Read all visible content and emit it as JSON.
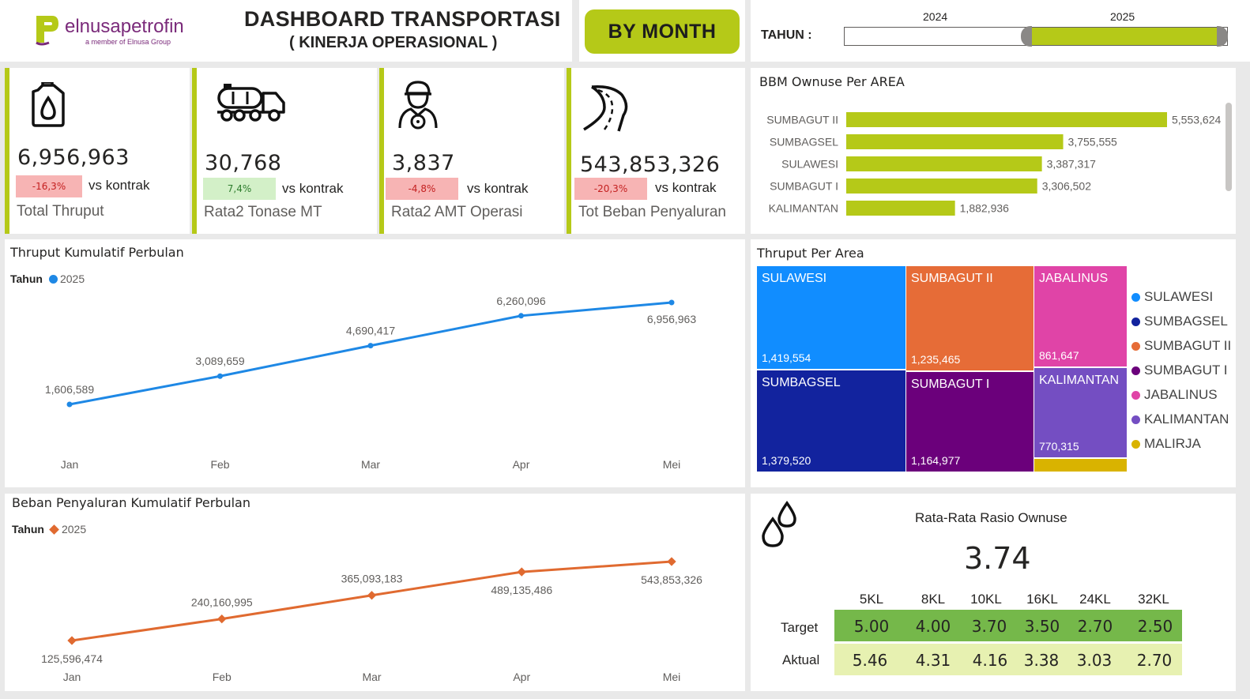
{
  "header": {
    "logo_name": "elnusapetrofin",
    "logo_tagline": "a member of Elnusa Group",
    "title": "DASHBOARD TRANSPORTASI",
    "subtitle": "( KINERJA OPERASIONAL )",
    "by_month_button": "BY MONTH",
    "year_slicer": {
      "label": "TAHUN :",
      "years": [
        "2024",
        "2025"
      ],
      "selected": "2025"
    }
  },
  "kpis": [
    {
      "icon": "fuel-can-icon",
      "value": "6,956,963",
      "badge": "-16,3%",
      "badge_type": "negative",
      "vs": "vs kontrak",
      "label": "Total Thruput"
    },
    {
      "icon": "tanker-truck-icon",
      "value": "30,768",
      "badge": "7,4%",
      "badge_type": "positive",
      "vs": "vs kontrak",
      "label": "Rata2 Tonase MT"
    },
    {
      "icon": "driver-icon",
      "value": "3,837",
      "badge": "-4,8%",
      "badge_type": "negative",
      "vs": "vs kontrak",
      "label": "Rata2 AMT Operasi"
    },
    {
      "icon": "road-icon",
      "value": "543,853,326",
      "badge": "-20,3%",
      "badge_type": "negative",
      "vs": "vs kontrak",
      "label": "Tot Beban Penyaluran"
    }
  ],
  "colors": {
    "accent": "#b5c918",
    "line_blue": "#1e88e5",
    "line_orange": "#e06a30",
    "negative_bg": "#f7b4b4",
    "positive_bg": "#d3f0c8"
  },
  "bbm_chart": {
    "title": "BBM Ownuse Per AREA",
    "chart_data": {
      "type": "bar",
      "orientation": "horizontal",
      "categories": [
        "SUMBAGUT II",
        "SUMBAGSEL",
        "SULAWESI",
        "SUMBAGUT I",
        "KALIMANTAN"
      ],
      "values": [
        5553624,
        3755555,
        3387317,
        3306502,
        1882936
      ],
      "value_labels": [
        "5,553,624",
        "3,755,555",
        "3,387,317",
        "3,306,502",
        "1,882,936"
      ],
      "color": "#b5c918"
    }
  },
  "thruput_chart": {
    "title": "Thruput Kumulatif Perbulan",
    "legend_label": "Tahun",
    "legend_series": "2025",
    "chart_data": {
      "type": "line",
      "categories": [
        "Jan",
        "Feb",
        "Mar",
        "Apr",
        "Mei"
      ],
      "series": [
        {
          "name": "2025",
          "values": [
            1606589,
            3089659,
            4690417,
            6260096,
            6956963
          ]
        }
      ],
      "value_labels": [
        "1,606,589",
        "3,089,659",
        "4,690,417",
        "6,260,096",
        "6,956,963"
      ],
      "color": "#1e88e5"
    }
  },
  "beban_chart": {
    "title": "Beban Penyaluran Kumulatif Perbulan",
    "legend_label": "Tahun",
    "legend_series": "2025",
    "chart_data": {
      "type": "line",
      "categories": [
        "Jan",
        "Feb",
        "Mar",
        "Apr",
        "Mei"
      ],
      "series": [
        {
          "name": "2025",
          "values": [
            125596474,
            240160995,
            365093183,
            489135486,
            543853326
          ]
        }
      ],
      "value_labels": [
        "125,596,474",
        "240,160,995",
        "365,093,183",
        "489,135,486",
        "543,853,326"
      ],
      "color": "#e06a30"
    }
  },
  "treemap": {
    "title": "Thruput Per Area",
    "chart_data": {
      "type": "treemap",
      "items": [
        {
          "name": "SULAWESI",
          "value": 1419554,
          "label": "1,419,554",
          "color": "#118dff"
        },
        {
          "name": "SUMBAGSEL",
          "value": 1379520,
          "label": "1,379,520",
          "color": "#12239e"
        },
        {
          "name": "SUMBAGUT II",
          "value": 1235465,
          "label": "1,235,465",
          "color": "#e66c37"
        },
        {
          "name": "SUMBAGUT I",
          "value": 1164977,
          "label": "1,164,977",
          "color": "#6b007b"
        },
        {
          "name": "JABALINUS",
          "value": 861647,
          "label": "861,647",
          "color": "#e044a7"
        },
        {
          "name": "KALIMANTAN",
          "value": 770315,
          "label": "770,315",
          "color": "#744ec2"
        },
        {
          "name": "MALIRJA",
          "value": null,
          "label": "",
          "color": "#d9b300"
        }
      ]
    },
    "legend": [
      "SULAWESI",
      "SUMBAGSEL",
      "SUMBAGUT II",
      "SUMBAGUT I",
      "JABALINUS",
      "KALIMANTAN",
      "MALIRJA"
    ]
  },
  "ratio": {
    "title": "Rata-Rata Rasio Ownuse",
    "value": "3.74",
    "columns": [
      "5KL",
      "8KL",
      "10KL",
      "16KL",
      "24KL",
      "32KL"
    ],
    "rows": [
      {
        "label": "Target",
        "values": [
          "5.00",
          "4.00",
          "3.70",
          "3.50",
          "2.70",
          "2.50"
        ]
      },
      {
        "label": "Aktual",
        "values": [
          "5.46",
          "4.31",
          "4.16",
          "3.38",
          "3.03",
          "2.70"
        ]
      }
    ]
  }
}
